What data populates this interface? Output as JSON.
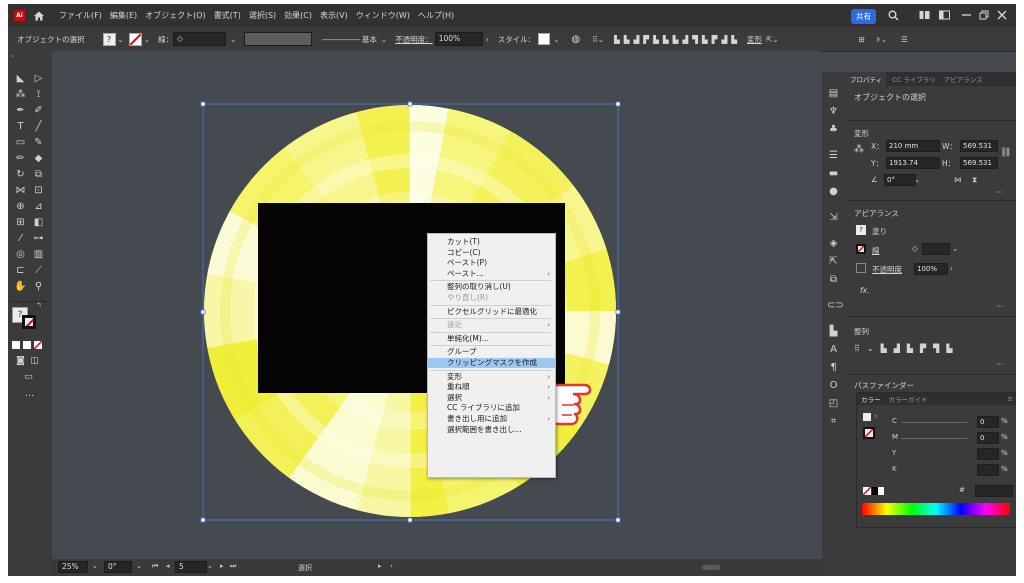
{
  "app": {
    "logo_text": "Ai"
  },
  "menu": [
    "ファイル(F)",
    "編集(E)",
    "オブジェクト(O)",
    "書式(T)",
    "選択(S)",
    "効果(C)",
    "表示(V)",
    "ウィンドウ(W)",
    "ヘルプ(H)"
  ],
  "share_label": "共有",
  "control_bar": {
    "selection_label": "オブジェクトの選択",
    "stroke_label": "線：",
    "stroke_style": "基本",
    "opacity_label": "不透明度：",
    "opacity_value": "100%",
    "style_label": "スタイル：",
    "transform_label": "変形"
  },
  "status_bar": {
    "zoom": "25%",
    "rotation": "0°",
    "artboard": "5",
    "mode": "選択"
  },
  "properties_panel": {
    "tabs": [
      "プロパティ",
      "CC ライブラリ",
      "アピアランス"
    ],
    "section_title": "オブジェクトの選択",
    "transform_title": "変形",
    "x_label": "X：",
    "x_value": "210 mm",
    "y_label": "Y：",
    "y_value": "1913.74",
    "w_label": "W：",
    "w_value": "569.531",
    "h_label": "H：",
    "h_value": "569.531",
    "angle_value": "0°",
    "appearance_title": "アピアランス",
    "fill_label": "塗り",
    "stroke_label": "線",
    "opacity_label": "不透明度",
    "opacity_value": "100%",
    "fx_label": "fx.",
    "align_title": "整列",
    "pathfinder_title": "パスファインダー"
  },
  "color_panel": {
    "tabs": [
      "カラー",
      "カラーガイド"
    ],
    "channels": [
      {
        "label": "C",
        "value": "0",
        "unit": "%"
      },
      {
        "label": "M",
        "value": "0",
        "unit": "%"
      },
      {
        "label": "Y",
        "value": "",
        "unit": "%"
      },
      {
        "label": "K",
        "value": "",
        "unit": "%"
      }
    ],
    "hex_symbol": "#"
  },
  "context_menu": [
    {
      "label": "カット(T)",
      "enabled": true
    },
    {
      "label": "コピー(C)",
      "enabled": true
    },
    {
      "label": "ペースト(P)",
      "enabled": true
    },
    {
      "label": "ペースト...",
      "enabled": true,
      "submenu": true
    },
    {
      "sep": true
    },
    {
      "label": "整列の取り消し(U)",
      "enabled": true
    },
    {
      "label": "やり直し(R)",
      "enabled": false
    },
    {
      "sep": true
    },
    {
      "label": "ピクセルグリッドに最適化",
      "enabled": true
    },
    {
      "sep": true
    },
    {
      "label": "遠近",
      "enabled": false,
      "submenu": true
    },
    {
      "sep": true
    },
    {
      "label": "単純化(M)...",
      "enabled": true
    },
    {
      "sep": true
    },
    {
      "label": "グループ",
      "enabled": true
    },
    {
      "label": "クリッピングマスクを作成",
      "enabled": true,
      "highlighted": true
    },
    {
      "sep": true
    },
    {
      "label": "変形",
      "enabled": true,
      "submenu": true
    },
    {
      "label": "重ね順",
      "enabled": true,
      "submenu": true
    },
    {
      "label": "選択",
      "enabled": true,
      "submenu": true
    },
    {
      "label": "CC ライブラリに追加",
      "enabled": true
    },
    {
      "label": "書き出し用に追加",
      "enabled": true,
      "submenu": true
    },
    {
      "label": "選択範囲を書き出し...",
      "enabled": true
    }
  ],
  "colors": {
    "accent": "#2d6be4",
    "artwork_yellow": "#f3f03c",
    "mask_rect": "#050505",
    "menu_highlight": "#9cc7f0",
    "pointer_red": "#e5352d"
  }
}
